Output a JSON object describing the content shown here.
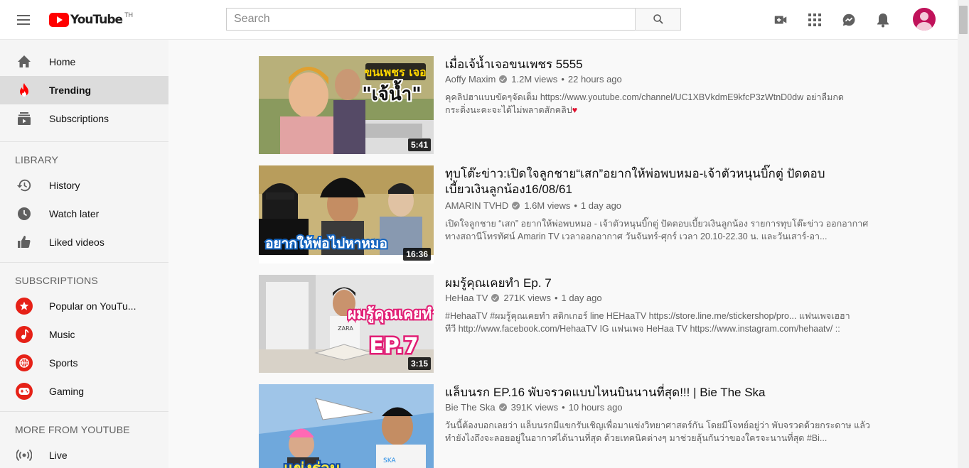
{
  "header": {
    "logo_text": "YouTube",
    "region": "TH",
    "search_placeholder": "Search"
  },
  "sidebar": {
    "main": [
      {
        "label": "Home",
        "icon": "home-icon"
      },
      {
        "label": "Trending",
        "icon": "trending-icon",
        "active": true
      },
      {
        "label": "Subscriptions",
        "icon": "subscriptions-icon"
      }
    ],
    "library_heading": "LIBRARY",
    "library": [
      {
        "label": "History",
        "icon": "history-icon"
      },
      {
        "label": "Watch later",
        "icon": "clock-icon"
      },
      {
        "label": "Liked videos",
        "icon": "thumbs-up-icon"
      }
    ],
    "subscriptions_heading": "SUBSCRIPTIONS",
    "subscriptions": [
      {
        "label": "Popular on YouTu...",
        "icon": "star-icon"
      },
      {
        "label": "Music",
        "icon": "music-note-icon"
      },
      {
        "label": "Sports",
        "icon": "sports-ball-icon"
      },
      {
        "label": "Gaming",
        "icon": "gamepad-icon"
      }
    ],
    "more_heading": "MORE FROM YOUTUBE",
    "more": [
      {
        "label": "Live",
        "icon": "live-broadcast-icon"
      }
    ]
  },
  "videos": [
    {
      "title": "เมื่อเจ้น้ำเจอขนเพชร 5555",
      "channel": "Aoffy Maxim",
      "views": "1.2M views",
      "age": "22 hours ago",
      "desc1": "คุคลิปฮาแบบขัดๆจัดเต็ม https://www.youtube.com/channel/UC1XBVkdmE9kfcP3zWtnD0dw อย่าลืมกด",
      "desc2": "กระดิ่งนะคะจะได้ไม่พลาดสักคลิป",
      "duration": "5:41",
      "thumb_text": "ขนเพชร เจอ \"เจ้น้ำ\""
    },
    {
      "title": "ทุบโต๊ะข่าว:เปิดใจลูกชาย“เสก”อยากให้พ่อพบหมอ-เจ้าตัวหนุนบิ๊กตู่ ปัดตอบ เบี้ยวเงินลูกน้อง16/08/61",
      "channel": "AMARIN TVHD",
      "views": "1.6M views",
      "age": "1 day ago",
      "desc1": "เปิดใจลูกชาย “เสก” อยากให้พ่อพบหมอ - เจ้าตัวหนุนบิ๊กตู่ ปัดตอบเบี้ยวเงินลูกน้อง รายการทุบโต๊ะข่าว ออกอากาศ",
      "desc2": "ทางสถานีโทรทัศน์ Amarin TV เวลาออกอากาศ วันจันทร์-ศุกร์ เวลา 20.10-22.30 น. และวันเสาร์-อา...",
      "duration": "16:36",
      "thumb_text": "อยากให้พ่อไปหาหมอ"
    },
    {
      "title": "ผมรู้คุณเคยทำ Ep. 7",
      "channel": "HeHaa TV",
      "views": "271K views",
      "age": "1 day ago",
      "desc1": "#HehaaTV #ผมรู้คุณเคยทำ สติกเกอร์ line HEHaaTV https://store.line.me/stickershop/pro... แฟนเพจเฮฮา",
      "desc2": "ทีวี http://www.facebook.com/HehaaTV IG แฟนเพจ HeHaa TV https://www.instagram.com/hehaatv/ ::",
      "duration": "3:15",
      "thumb_text": "ผมรู้คุณเคยทำ EP.7"
    },
    {
      "title": "แล็บนรก EP.16 พับจรวดแบบไหนบินนานที่สุด!!! | Bie The Ska",
      "channel": "Bie The Ska",
      "views": "391K views",
      "age": "10 hours ago",
      "desc1": "วันนี้ต้องบอกเลยว่า แล็บนรกมีแขกรับเชิญเพื่อมาแข่งวิทยาศาสตร์กัน โดยมีโจทย์อยู่ว่า พับจรวดด้วยกระดาษ แล้ว",
      "desc2": "ทำยังไงถึงจะลอยอยู่ในอากาศได้นานที่สุด ด้วยเทคนิคต่างๆ มาช่วยลุ้นกันว่าของใครจะนานที่สุด #Bi...",
      "thumb_text": "แข่งร่อน เครื่องบินกระดาษ"
    }
  ],
  "colors": {
    "brand_red": "#ff0000",
    "active_bg": "#dcdcdc"
  }
}
